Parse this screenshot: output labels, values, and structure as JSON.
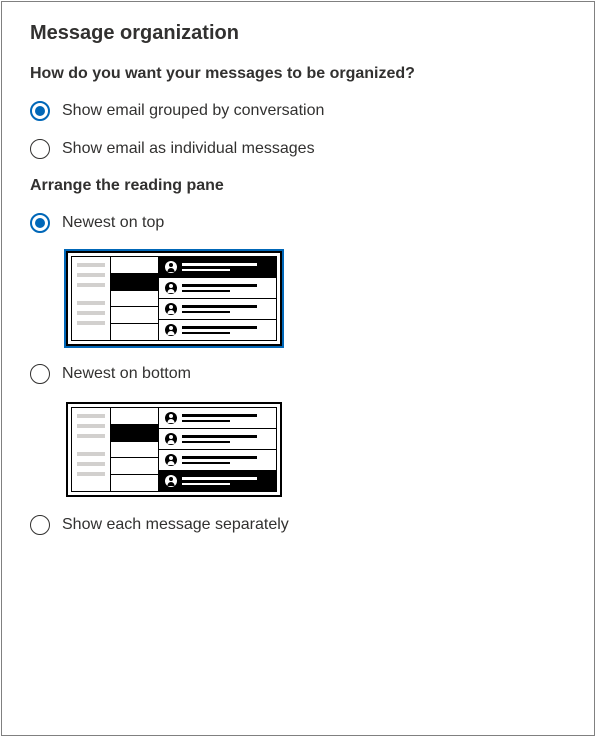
{
  "title": "Message organization",
  "question": "How do you want your messages to be organized?",
  "group1": {
    "opt_grouped": {
      "label": "Show email grouped by conversation",
      "selected": true
    },
    "opt_individual": {
      "label": "Show email as individual messages",
      "selected": false
    }
  },
  "arrange_heading": "Arrange the reading pane",
  "group2": {
    "opt_newest_top": {
      "label": "Newest on top",
      "selected": true
    },
    "opt_newest_bottom": {
      "label": "Newest on bottom",
      "selected": false
    },
    "opt_separate": {
      "label": "Show each message separately",
      "selected": false
    }
  }
}
